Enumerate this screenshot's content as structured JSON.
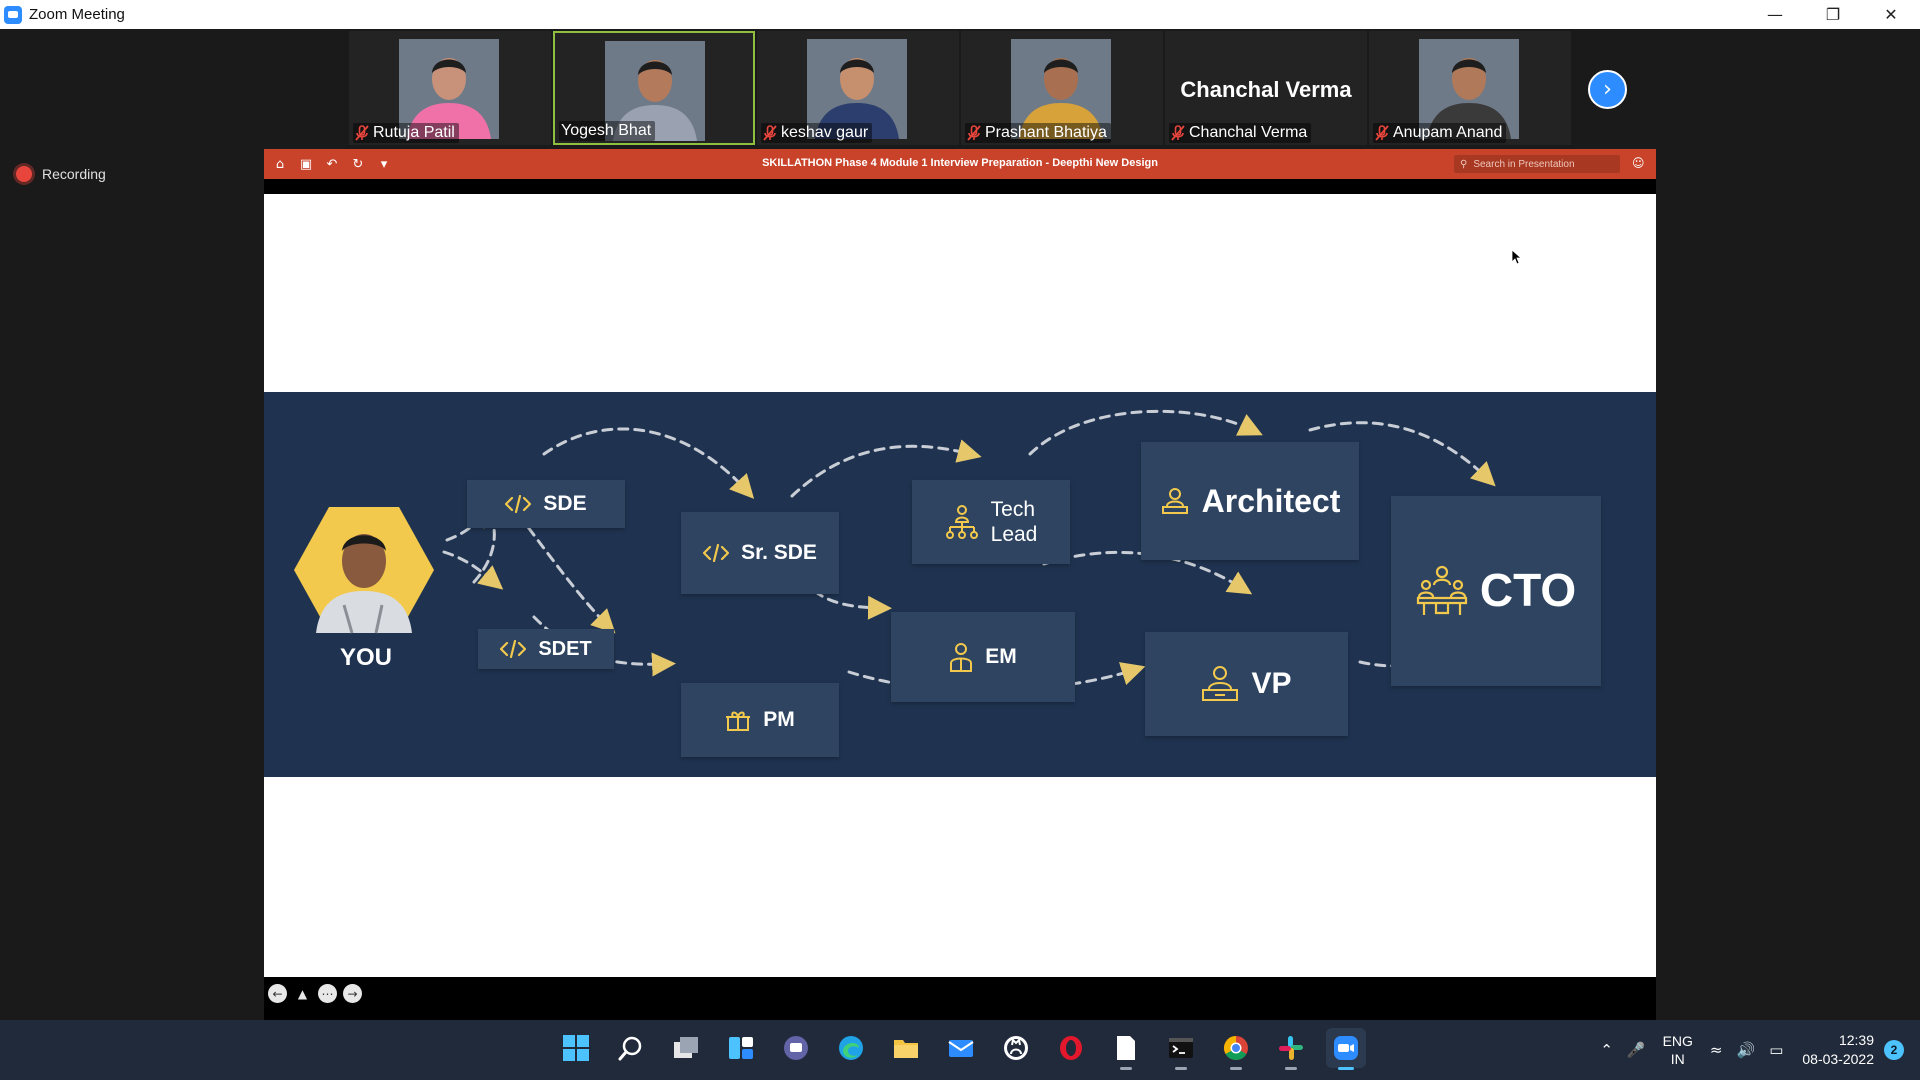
{
  "window": {
    "title": "Zoom Meeting"
  },
  "participants": [
    {
      "name": "Rutuja Patil",
      "muted": true,
      "video": true,
      "active": false,
      "shirt": "#f070a8",
      "skin": "#c8927a"
    },
    {
      "name": "Yogesh Bhat",
      "muted": false,
      "video": true,
      "active": true,
      "shirt": "#9aa2b2",
      "skin": "#b37a5c"
    },
    {
      "name": "keshav gaur",
      "muted": true,
      "video": true,
      "active": false,
      "shirt": "#2c3e6e",
      "skin": "#c68f6e"
    },
    {
      "name": "Prashant Bhatiya",
      "muted": true,
      "video": true,
      "active": false,
      "shirt": "#d8a23a",
      "skin": "#a87050"
    },
    {
      "name": "Chanchal Verma",
      "muted": true,
      "video": false,
      "active": false,
      "display_name": "Chanchal Verma"
    },
    {
      "name": "Anupam Anand",
      "muted": true,
      "video": true,
      "active": false,
      "shirt": "#3a3a3a",
      "skin": "#b07a5a"
    }
  ],
  "recording": {
    "label": "Recording"
  },
  "presentation": {
    "title": "SKILLATHON Phase 4  Module 1  Interview Preparation - Deepthi New Design",
    "search_placeholder": "Search in Presentation"
  },
  "career": {
    "you": "YOU",
    "sde": "SDE",
    "sdet": "SDET",
    "sr_sde": "Sr. SDE",
    "pm": "PM",
    "tech_lead_1": "Tech",
    "tech_lead_2": "Lead",
    "em": "EM",
    "architect": "Architect",
    "vp": "VP",
    "cto": "CTO"
  },
  "taskbar": {
    "apps": [
      "windows-start-icon",
      "search-icon",
      "task-view-icon",
      "widgets-icon",
      "teams-chat-icon",
      "edge-icon",
      "file-explorer-icon",
      "mail-icon",
      "github-icon",
      "opera-icon",
      "notepad-icon",
      "terminal-icon",
      "chrome-icon",
      "slack-icon",
      "zoom-icon"
    ],
    "lang_1": "ENG",
    "lang_2": "IN",
    "time": "12:39",
    "date": "08-03-2022",
    "notifications": "2"
  },
  "colors": {
    "accent": "#2d8cff",
    "ppt_bar": "#c8432a",
    "slide_band": "#1f3350",
    "box": "#2e4461",
    "icon_gold": "#f2c94c"
  }
}
